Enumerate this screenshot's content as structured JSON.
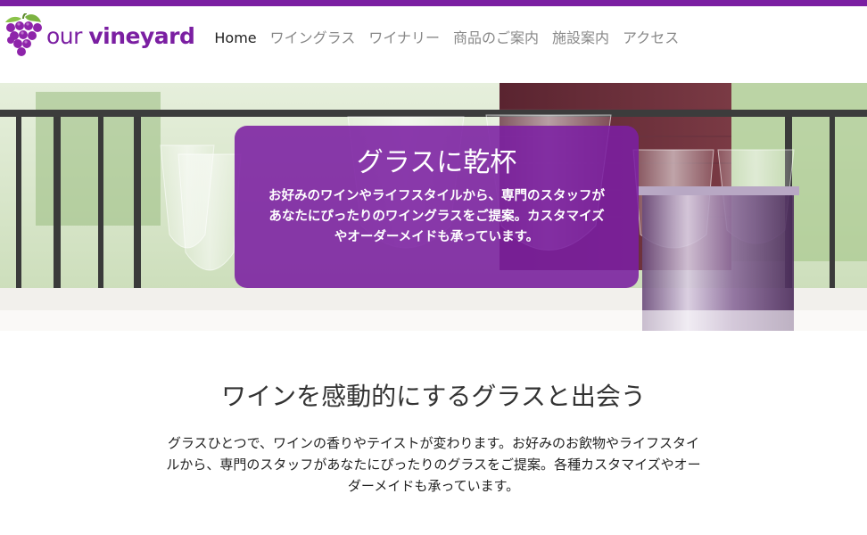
{
  "colors": {
    "brand": "#7b1fa2",
    "nav_text": "#888888",
    "nav_active": "#222222"
  },
  "header": {
    "logo_icon": "grape-icon",
    "logo_prefix": "our ",
    "logo_bold": "vineyard",
    "nav": [
      {
        "label": "Home",
        "active": true
      },
      {
        "label": "ワイングラス",
        "active": false
      },
      {
        "label": "ワイナリー",
        "active": false
      },
      {
        "label": "商品のご案内",
        "active": false
      },
      {
        "label": "施設案内",
        "active": false
      },
      {
        "label": "アクセス",
        "active": false
      }
    ]
  },
  "hero": {
    "title": "グラスに乾杯",
    "description": "お好みのワインやライフスタイルから、専門のスタッフがあなたにぴったりのワイングラスをご提案。カスタマイズやオーダーメイドも承っています。"
  },
  "intro": {
    "title": "ワインを感動的にするグラスと出会う",
    "text": "グラスひとつで、ワインの香りやテイストが変わります。お好みのお飲物やライフスタイルから、専門のスタッフがあなたにぴったりのグラスをご提案。各種カスタマイズやオーダーメイドも承っています。"
  }
}
